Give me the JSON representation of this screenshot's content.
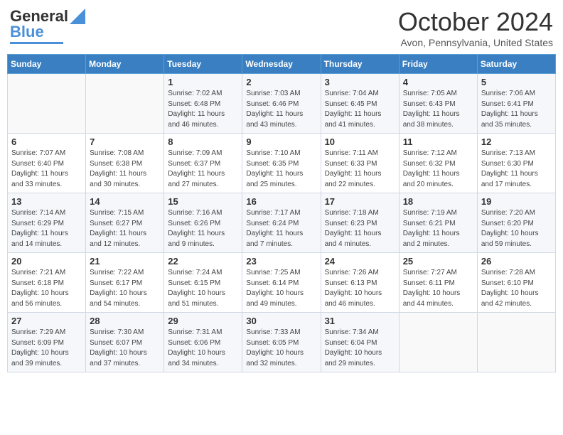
{
  "header": {
    "logo_line1": "General",
    "logo_line2": "Blue",
    "month": "October 2024",
    "location": "Avon, Pennsylvania, United States"
  },
  "weekdays": [
    "Sunday",
    "Monday",
    "Tuesday",
    "Wednesday",
    "Thursday",
    "Friday",
    "Saturday"
  ],
  "weeks": [
    [
      {
        "day": "",
        "sunrise": "",
        "sunset": "",
        "daylight": ""
      },
      {
        "day": "",
        "sunrise": "",
        "sunset": "",
        "daylight": ""
      },
      {
        "day": "1",
        "sunrise": "Sunrise: 7:02 AM",
        "sunset": "Sunset: 6:48 PM",
        "daylight": "Daylight: 11 hours and 46 minutes."
      },
      {
        "day": "2",
        "sunrise": "Sunrise: 7:03 AM",
        "sunset": "Sunset: 6:46 PM",
        "daylight": "Daylight: 11 hours and 43 minutes."
      },
      {
        "day": "3",
        "sunrise": "Sunrise: 7:04 AM",
        "sunset": "Sunset: 6:45 PM",
        "daylight": "Daylight: 11 hours and 41 minutes."
      },
      {
        "day": "4",
        "sunrise": "Sunrise: 7:05 AM",
        "sunset": "Sunset: 6:43 PM",
        "daylight": "Daylight: 11 hours and 38 minutes."
      },
      {
        "day": "5",
        "sunrise": "Sunrise: 7:06 AM",
        "sunset": "Sunset: 6:41 PM",
        "daylight": "Daylight: 11 hours and 35 minutes."
      }
    ],
    [
      {
        "day": "6",
        "sunrise": "Sunrise: 7:07 AM",
        "sunset": "Sunset: 6:40 PM",
        "daylight": "Daylight: 11 hours and 33 minutes."
      },
      {
        "day": "7",
        "sunrise": "Sunrise: 7:08 AM",
        "sunset": "Sunset: 6:38 PM",
        "daylight": "Daylight: 11 hours and 30 minutes."
      },
      {
        "day": "8",
        "sunrise": "Sunrise: 7:09 AM",
        "sunset": "Sunset: 6:37 PM",
        "daylight": "Daylight: 11 hours and 27 minutes."
      },
      {
        "day": "9",
        "sunrise": "Sunrise: 7:10 AM",
        "sunset": "Sunset: 6:35 PM",
        "daylight": "Daylight: 11 hours and 25 minutes."
      },
      {
        "day": "10",
        "sunrise": "Sunrise: 7:11 AM",
        "sunset": "Sunset: 6:33 PM",
        "daylight": "Daylight: 11 hours and 22 minutes."
      },
      {
        "day": "11",
        "sunrise": "Sunrise: 7:12 AM",
        "sunset": "Sunset: 6:32 PM",
        "daylight": "Daylight: 11 hours and 20 minutes."
      },
      {
        "day": "12",
        "sunrise": "Sunrise: 7:13 AM",
        "sunset": "Sunset: 6:30 PM",
        "daylight": "Daylight: 11 hours and 17 minutes."
      }
    ],
    [
      {
        "day": "13",
        "sunrise": "Sunrise: 7:14 AM",
        "sunset": "Sunset: 6:29 PM",
        "daylight": "Daylight: 11 hours and 14 minutes."
      },
      {
        "day": "14",
        "sunrise": "Sunrise: 7:15 AM",
        "sunset": "Sunset: 6:27 PM",
        "daylight": "Daylight: 11 hours and 12 minutes."
      },
      {
        "day": "15",
        "sunrise": "Sunrise: 7:16 AM",
        "sunset": "Sunset: 6:26 PM",
        "daylight": "Daylight: 11 hours and 9 minutes."
      },
      {
        "day": "16",
        "sunrise": "Sunrise: 7:17 AM",
        "sunset": "Sunset: 6:24 PM",
        "daylight": "Daylight: 11 hours and 7 minutes."
      },
      {
        "day": "17",
        "sunrise": "Sunrise: 7:18 AM",
        "sunset": "Sunset: 6:23 PM",
        "daylight": "Daylight: 11 hours and 4 minutes."
      },
      {
        "day": "18",
        "sunrise": "Sunrise: 7:19 AM",
        "sunset": "Sunset: 6:21 PM",
        "daylight": "Daylight: 11 hours and 2 minutes."
      },
      {
        "day": "19",
        "sunrise": "Sunrise: 7:20 AM",
        "sunset": "Sunset: 6:20 PM",
        "daylight": "Daylight: 10 hours and 59 minutes."
      }
    ],
    [
      {
        "day": "20",
        "sunrise": "Sunrise: 7:21 AM",
        "sunset": "Sunset: 6:18 PM",
        "daylight": "Daylight: 10 hours and 56 minutes."
      },
      {
        "day": "21",
        "sunrise": "Sunrise: 7:22 AM",
        "sunset": "Sunset: 6:17 PM",
        "daylight": "Daylight: 10 hours and 54 minutes."
      },
      {
        "day": "22",
        "sunrise": "Sunrise: 7:24 AM",
        "sunset": "Sunset: 6:15 PM",
        "daylight": "Daylight: 10 hours and 51 minutes."
      },
      {
        "day": "23",
        "sunrise": "Sunrise: 7:25 AM",
        "sunset": "Sunset: 6:14 PM",
        "daylight": "Daylight: 10 hours and 49 minutes."
      },
      {
        "day": "24",
        "sunrise": "Sunrise: 7:26 AM",
        "sunset": "Sunset: 6:13 PM",
        "daylight": "Daylight: 10 hours and 46 minutes."
      },
      {
        "day": "25",
        "sunrise": "Sunrise: 7:27 AM",
        "sunset": "Sunset: 6:11 PM",
        "daylight": "Daylight: 10 hours and 44 minutes."
      },
      {
        "day": "26",
        "sunrise": "Sunrise: 7:28 AM",
        "sunset": "Sunset: 6:10 PM",
        "daylight": "Daylight: 10 hours and 42 minutes."
      }
    ],
    [
      {
        "day": "27",
        "sunrise": "Sunrise: 7:29 AM",
        "sunset": "Sunset: 6:09 PM",
        "daylight": "Daylight: 10 hours and 39 minutes."
      },
      {
        "day": "28",
        "sunrise": "Sunrise: 7:30 AM",
        "sunset": "Sunset: 6:07 PM",
        "daylight": "Daylight: 10 hours and 37 minutes."
      },
      {
        "day": "29",
        "sunrise": "Sunrise: 7:31 AM",
        "sunset": "Sunset: 6:06 PM",
        "daylight": "Daylight: 10 hours and 34 minutes."
      },
      {
        "day": "30",
        "sunrise": "Sunrise: 7:33 AM",
        "sunset": "Sunset: 6:05 PM",
        "daylight": "Daylight: 10 hours and 32 minutes."
      },
      {
        "day": "31",
        "sunrise": "Sunrise: 7:34 AM",
        "sunset": "Sunset: 6:04 PM",
        "daylight": "Daylight: 10 hours and 29 minutes."
      },
      {
        "day": "",
        "sunrise": "",
        "sunset": "",
        "daylight": ""
      },
      {
        "day": "",
        "sunrise": "",
        "sunset": "",
        "daylight": ""
      }
    ]
  ]
}
